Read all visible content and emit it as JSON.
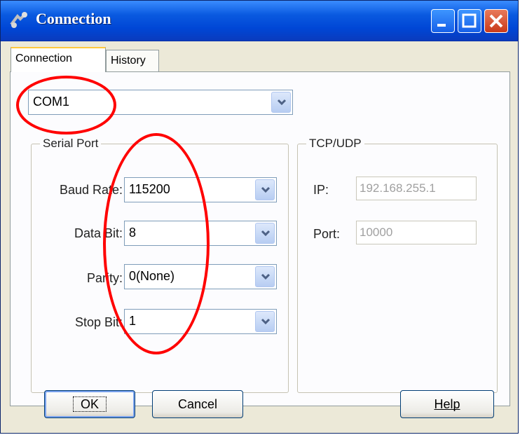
{
  "window": {
    "title": "Connection"
  },
  "tabs": [
    {
      "label": "Connection"
    },
    {
      "label": "History"
    }
  ],
  "port_select": {
    "value": "COM1"
  },
  "serial": {
    "legend": "Serial Port",
    "fields": [
      {
        "label": "Baud Rate:",
        "value": "115200"
      },
      {
        "label": "Data Bit:",
        "value": "8"
      },
      {
        "label": "Parity:",
        "value": "0(None)"
      },
      {
        "label": "Stop Bit:",
        "value": "1"
      }
    ]
  },
  "tcp": {
    "legend": "TCP/UDP",
    "ip_label": "IP:",
    "ip_value": "192.168.255.1",
    "port_label": "Port:",
    "port_value": "10000"
  },
  "buttons": {
    "ok": "OK",
    "cancel": "Cancel",
    "help": "Help"
  },
  "colors": {
    "annotation": "#ff0000",
    "titlebar": "#0a5ae0"
  }
}
